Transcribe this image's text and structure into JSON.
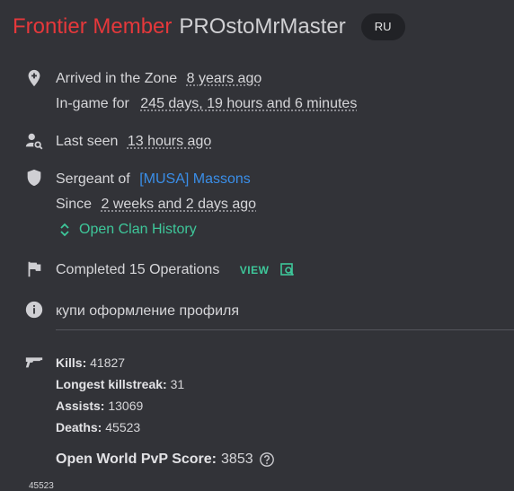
{
  "header": {
    "rank": "Frontier Member",
    "username": "PROstoMrMaster",
    "region": "RU"
  },
  "info": {
    "arrived_label": "Arrived in the Zone",
    "arrived_value": "8 years ago",
    "ingame_label": "In-game for",
    "ingame_value": "245 days, 19 hours and 6 minutes",
    "lastseen_label": "Last seen",
    "lastseen_value": "13 hours ago",
    "sergeant_label": "Sergeant of",
    "clan_name": "[MUSA] Massons",
    "since_label": "Since",
    "since_value": "2 weeks and 2 days ago",
    "clan_history": "Open Clan History",
    "operations": "Completed 15 Operations",
    "view_label": "VIEW",
    "status": "купи оформление профиля"
  },
  "stats": {
    "kills_label": "Kills:",
    "kills": "41827",
    "killstreak_label": "Longest killstreak:",
    "killstreak": "31",
    "assists_label": "Assists:",
    "assists": "13069",
    "deaths_label": "Deaths:",
    "deaths": "45523",
    "pvp_label": "Open World PvP Score:",
    "pvp_score": "3853",
    "cut_value": "45523"
  },
  "colors": {
    "background": "#323338",
    "rank": "#e5383b",
    "link": "#3a8ee8",
    "accent_green": "#3ec79a"
  },
  "icons": [
    "map-pin-plus-icon",
    "person-search-icon",
    "shield-icon",
    "chevron-up-down-icon",
    "flag-icon",
    "view-search-icon",
    "info-icon",
    "gun-icon",
    "help-circle-icon"
  ]
}
